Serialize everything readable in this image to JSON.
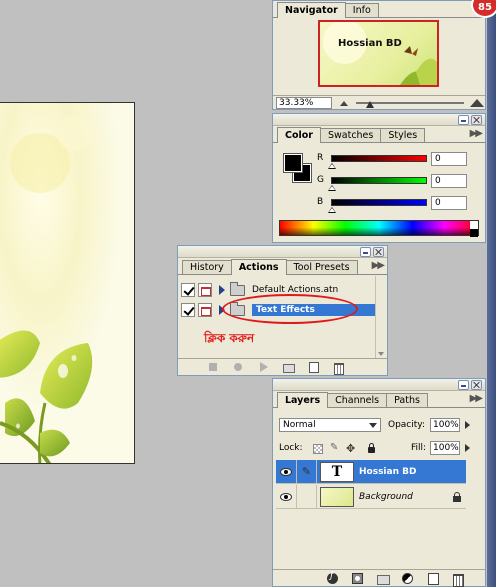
{
  "navigator": {
    "tabs": [
      "Navigator",
      "Info"
    ],
    "thumbnail_title": "Hossian BD",
    "zoom": "33.33%"
  },
  "color": {
    "tabs": [
      "Color",
      "Swatches",
      "Styles"
    ],
    "channels": [
      {
        "label": "R",
        "value": "0"
      },
      {
        "label": "G",
        "value": "0"
      },
      {
        "label": "B",
        "value": "0"
      }
    ]
  },
  "actions": {
    "tabs": [
      "History",
      "Actions",
      "Tool Presets"
    ],
    "items": [
      {
        "label": "Default Actions.atn"
      },
      {
        "label": "Text Effects"
      }
    ],
    "annotation": "ক্লিক করুন"
  },
  "layers": {
    "tabs": [
      "Layers",
      "Channels",
      "Paths"
    ],
    "blend_mode": "Normal",
    "opacity_label": "Opacity:",
    "opacity": "100%",
    "lock_label": "Lock:",
    "fill_label": "Fill:",
    "fill": "100%",
    "items": [
      {
        "name": "Hossian BD",
        "thumb": "T"
      },
      {
        "name": "Background"
      }
    ]
  },
  "badge": {
    "count": "85"
  },
  "colors": {
    "selection": "#3478d4",
    "annotation_red": "#e01a1a",
    "panel_bg": "#ece9d8"
  }
}
